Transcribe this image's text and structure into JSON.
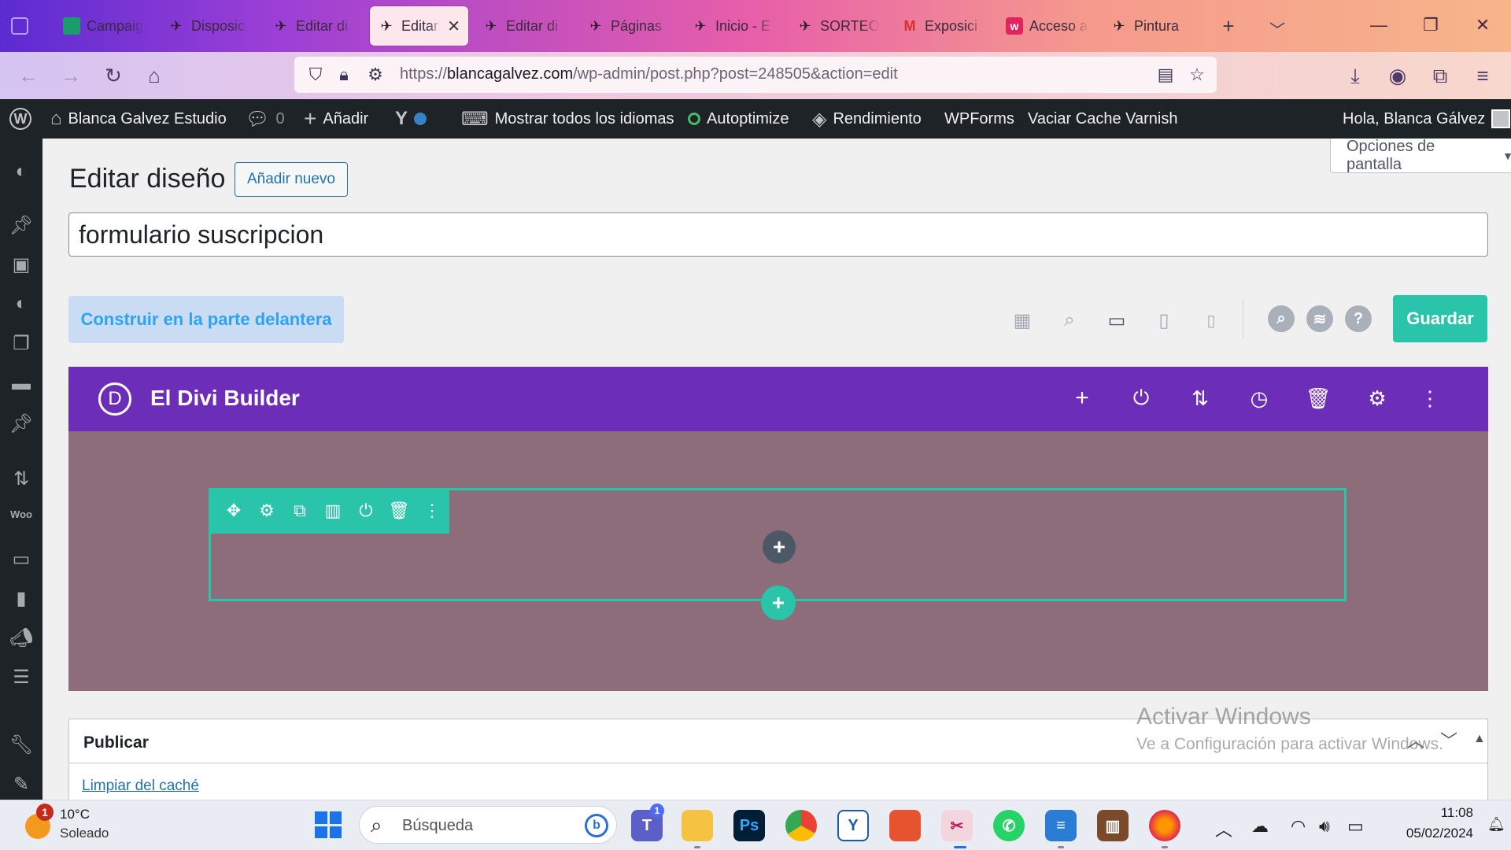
{
  "browser": {
    "tabs": [
      {
        "title": "Campaig",
        "icon": "campaign-favicon"
      },
      {
        "title": "Disposic",
        "icon": "bird-favicon"
      },
      {
        "title": "Editar di",
        "icon": "bird-favicon"
      },
      {
        "title": "Editar",
        "icon": "bird-favicon",
        "active": true
      },
      {
        "title": "Editar di",
        "icon": "bird-favicon"
      },
      {
        "title": "Páginas",
        "icon": "bird-favicon"
      },
      {
        "title": "Inicio - E",
        "icon": "bird-favicon"
      },
      {
        "title": "SORTEO",
        "icon": "bird-favicon"
      },
      {
        "title": "Exposici",
        "icon": "gmail-favicon"
      },
      {
        "title": "Acceso a",
        "icon": "w-favicon"
      },
      {
        "title": "Pintura",
        "icon": "bird-favicon"
      }
    ],
    "url_prefix": "https://",
    "url_host": "blancagalvez.com",
    "url_path": "/wp-admin/post.php?post=248505&action=edit"
  },
  "adminbar": {
    "site_name": "Blanca Galvez Estudio",
    "comments_count": "0",
    "add_label": "Añadir",
    "languages_label": "Mostrar todos los idiomas",
    "autoptimize_label": "Autoptimize",
    "performance_label": "Rendimiento",
    "wpforms_label": "WPForms",
    "varnish_label": "Vaciar Cache Varnish",
    "greeting": "Hola, Blanca Gálvez"
  },
  "editor": {
    "screen_options": "Opciones de pantalla",
    "page_title": "Editar diseño",
    "add_new": "Añadir nuevo",
    "post_title": "formulario suscripcion",
    "build_front": "Construir en la parte delantera",
    "save": "Guardar"
  },
  "divi": {
    "logo_letter": "D",
    "title": "El Divi Builder",
    "header_color": "#6c2eb9",
    "accent_color": "#29c4a9",
    "canvas_color": "#8c6d79"
  },
  "publish": {
    "title": "Publicar",
    "clear_cache": "Limpiar del caché"
  },
  "watermark": {
    "line1": "Activar Windows",
    "line2": "Ve a Configuración para activar Windows."
  },
  "taskbar": {
    "weather_temp": "10°C",
    "weather_desc": "Soleado",
    "weather_badge": "1",
    "search_placeholder": "Búsqueda",
    "teams_badge": "1",
    "time": "11:08",
    "date": "05/02/2024"
  }
}
